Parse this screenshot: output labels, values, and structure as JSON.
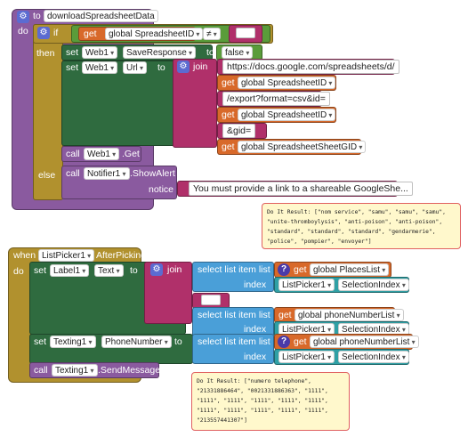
{
  "event1": {
    "to_kw": "to",
    "proc_name": "downloadSpreadsheetData",
    "do_kw": "do",
    "if_kw": "if",
    "then_kw": "then",
    "else_kw": "else",
    "get_kw": "get",
    "set_kw": "set",
    "call_kw": "call",
    "cond_var": "global SpreadsheetID",
    "cond_op": "≠",
    "set1_component": "Web1",
    "set1_prop": "SaveResponse",
    "set1_value": "false",
    "set2_component": "Web1",
    "set2_prop": "Url",
    "join_kw": "join",
    "join_items": [
      {
        "kind": "text",
        "value": "https://docs.google.com/spreadsheets/d/"
      },
      {
        "kind": "get",
        "value": "global SpreadsheetID"
      },
      {
        "kind": "text",
        "value": "/export?format=csv&id="
      },
      {
        "kind": "get",
        "value": "global SpreadsheetID"
      },
      {
        "kind": "text",
        "value": "&gid="
      },
      {
        "kind": "get",
        "value": "global SpreadsheetSheetGID"
      }
    ],
    "call1_component": "Web1",
    "call1_method": "Get",
    "call2_component": "Notifier1",
    "call2_method": "ShowAlert",
    "notice_kw": "notice",
    "notice_text": "You must provide a link to a shareable GoogleShe..."
  },
  "bubble1": {
    "text": "Do It Result: [\"nom service\", \"samu\", \"samu\", \"samu\", \"unite-thromboylysis\", \"anti-poison\", \"anti-poison\", \"standard\", \"standard\", \"standard\", \"gendarmerie\", \"police\", \"pompier\", \"envoyer\"]"
  },
  "event2": {
    "when_kw": "when",
    "component": "ListPicker1",
    "event": "AfterPicking",
    "do_kw": "do",
    "set_kw": "set",
    "to_kw": "to",
    "get_kw": "get",
    "call_kw": "call",
    "join_kw": "join",
    "set1_component": "Label1",
    "set1_prop": "Text",
    "select_kw": "select list item  list",
    "index_kw": "index",
    "list1": "global PlacesList",
    "idx_component": "ListPicker1",
    "idx_prop": "SelectionIndex",
    "list2": "global phoneNumberList",
    "set2_component": "Texting1",
    "set2_prop": "PhoneNumber",
    "list3": "global phoneNumberList",
    "call_component": "Texting1",
    "call_method": "SendMessage"
  },
  "bubble2": {
    "text": "Do It Result: [\"numero telephone\", \"21331886464\", \"0021331886363\", \"1111\", \"1111\", \"1111\", \"1111\", \"1111\", \"1111\", \"1111\", \"1111\", \"1111\", \"1111\", \"1111\", \"213557441307\"]"
  }
}
